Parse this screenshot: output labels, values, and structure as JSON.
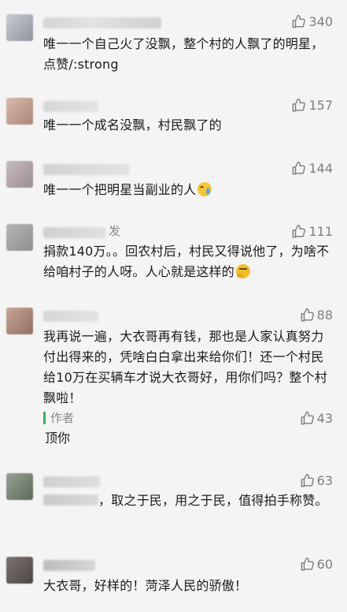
{
  "comments": [
    {
      "likes": "340",
      "text": "唯一一个自己火了没飘，整个村的人飘了的明星，点赞/:strong",
      "avatar_color": "#b8bcc4"
    },
    {
      "likes": "157",
      "text": "唯一一个成名没飘，村民飘了的",
      "avatar_color": "#c9a99c"
    },
    {
      "likes": "144",
      "text": "唯一一个把明星当副业的人",
      "avatar_color": "#b7aab0",
      "emoji": "crying-face"
    },
    {
      "likes": "111",
      "name_tail": "发",
      "text": "捐款140万。。回农村后，村民又得说他了，为啥不给咱村子的人呀。人心就是这样的",
      "avatar_color": "#a6a9a6",
      "emoji": "thinking-face"
    },
    {
      "likes": "88",
      "text": "我再说一遍，大衣哥再有钱，那也是人家认真努力付出得来的，凭啥白白拿出来给你们！还一个村民给10万在买辆车才说大衣哥好，用你们吗？整个村飘啦！",
      "avatar_color": "#b99a8c",
      "author_reply": {
        "tag": "作者",
        "likes": "43",
        "text": "顶你"
      }
    },
    {
      "likes": "63",
      "text": "，取之于民，用之于民，值得拍手称赞。",
      "avatar_color": "#7f8a7a"
    },
    {
      "likes": "60",
      "text": "大衣哥，好样的！菏泽人民的骄傲！",
      "avatar_color": "#6c6560"
    }
  ],
  "colors": {
    "background": "#f4f4f4",
    "text": "#1b1b1b",
    "meta": "#7e7e7e",
    "author_bar": "#35b35a"
  },
  "icons": {
    "like": "thumbs-up-outline-icon"
  }
}
